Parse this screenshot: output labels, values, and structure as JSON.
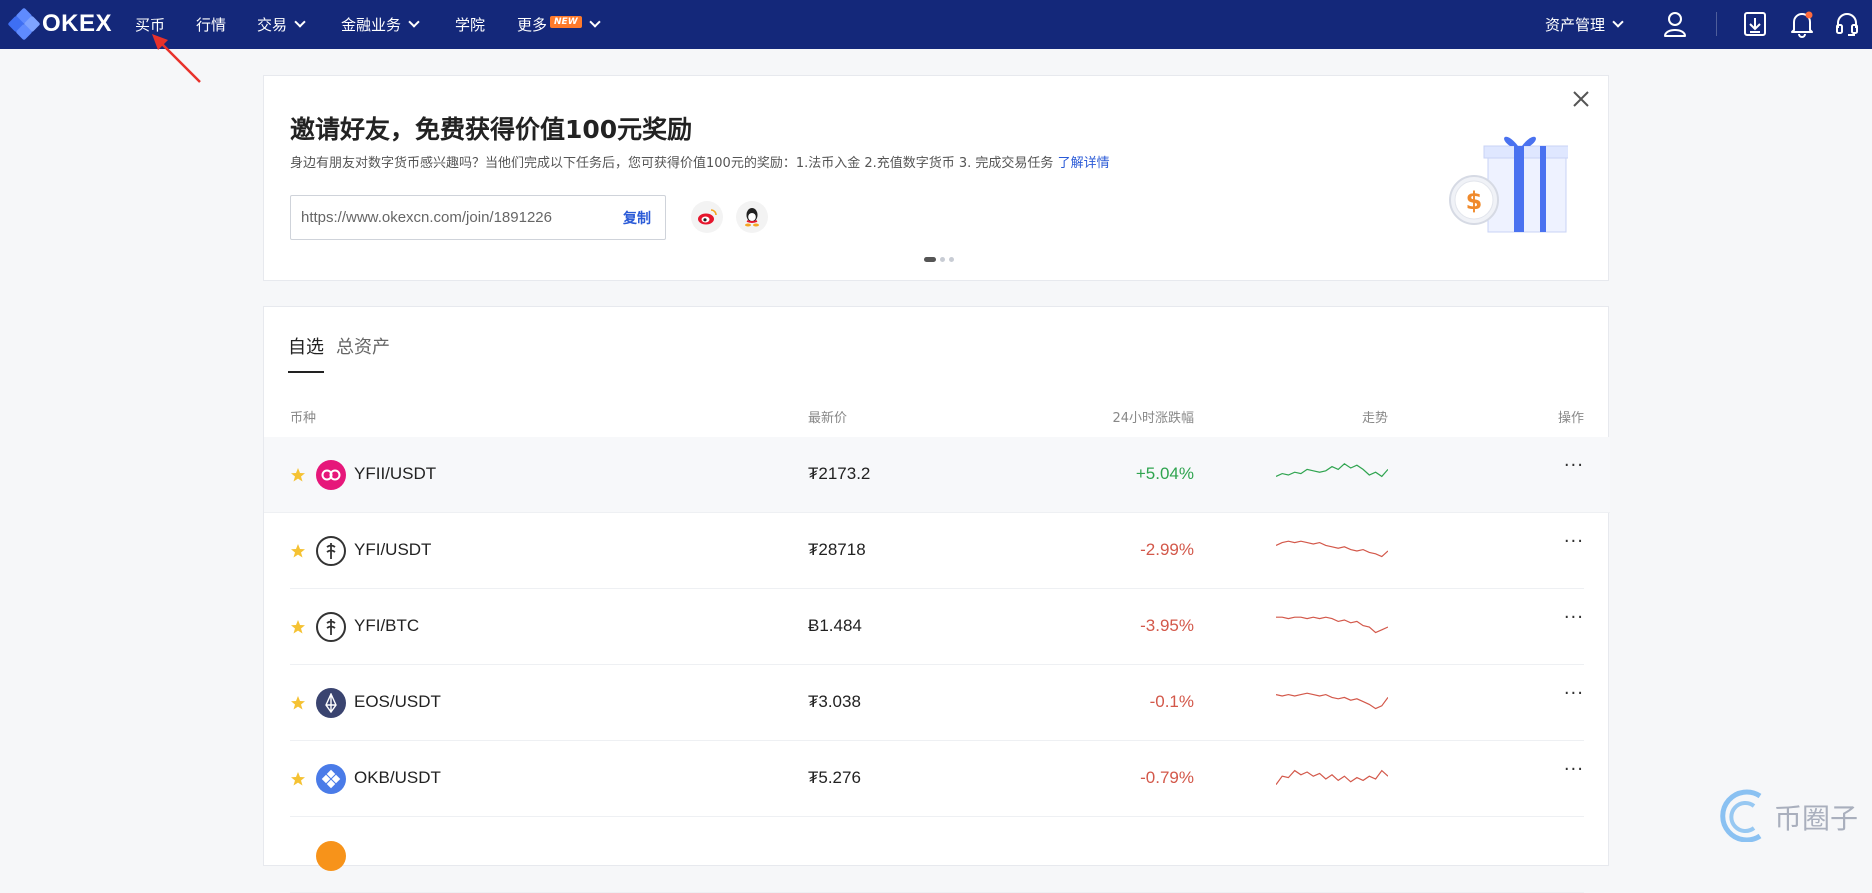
{
  "nav": {
    "logo_text": "OKEX",
    "items": [
      {
        "label": "买币",
        "has_dropdown": false
      },
      {
        "label": "行情",
        "has_dropdown": false
      },
      {
        "label": "交易",
        "has_dropdown": true
      },
      {
        "label": "金融业务",
        "has_dropdown": true
      },
      {
        "label": "学院",
        "has_dropdown": false
      },
      {
        "label": "更多",
        "has_dropdown": true,
        "badge": "NEW"
      }
    ],
    "asset_menu": "资产管理",
    "icons": [
      "user-icon",
      "download-icon",
      "bell-icon",
      "headset-icon"
    ],
    "bg_color": "#14287a"
  },
  "banner": {
    "title": "邀请好友，免费获得价值100元奖励",
    "desc": "身边有朋友对数字货币感兴趣吗？当他们完成以下任务后，您可获得价值100元的奖励：1.法币入金 2.充值数字货币 3. 完成交易任务",
    "desc_link": "了解详情",
    "invite_url": "https://www.okexcn.com/join/1891226",
    "copy_label": "复制",
    "share_icons": [
      "weibo-icon",
      "qq-icon"
    ],
    "carousel_pages": 3,
    "carousel_active": 1
  },
  "watchlist": {
    "tabs": [
      {
        "label": "自选",
        "active": true
      },
      {
        "label": "总资产",
        "active": false
      }
    ],
    "columns": {
      "coin": "币种",
      "price": "最新价",
      "change": "24小时涨跌幅",
      "trend": "走势",
      "action": "操作"
    },
    "rows": [
      {
        "pair": "YFII/USDT",
        "price": "₮2173.2",
        "change": "+5.04%",
        "direction": "up",
        "icon": "yfii-icon",
        "trend": [
          0.55,
          0.45,
          0.5,
          0.4,
          0.45,
          0.3,
          0.35,
          0.4,
          0.35,
          0.2,
          0.3,
          0.1,
          0.25,
          0.15,
          0.3,
          0.5,
          0.4,
          0.55,
          0.3
        ]
      },
      {
        "pair": "YFI/USDT",
        "price": "₮28718",
        "change": "-2.99%",
        "direction": "down",
        "icon": "yfi-icon",
        "trend": [
          0.3,
          0.2,
          0.15,
          0.2,
          0.15,
          0.2,
          0.25,
          0.2,
          0.3,
          0.35,
          0.4,
          0.35,
          0.45,
          0.5,
          0.45,
          0.55,
          0.6,
          0.7,
          0.5
        ]
      },
      {
        "pair": "YFI/BTC",
        "price": "Ƀ1.484",
        "change": "-3.95%",
        "direction": "down",
        "icon": "yfi-icon",
        "trend": [
          0.15,
          0.15,
          0.2,
          0.15,
          0.15,
          0.2,
          0.15,
          0.2,
          0.15,
          0.2,
          0.3,
          0.25,
          0.35,
          0.3,
          0.45,
          0.5,
          0.7,
          0.6,
          0.5
        ]
      },
      {
        "pair": "EOS/USDT",
        "price": "₮3.038",
        "change": "-0.1%",
        "direction": "down",
        "icon": "eos-icon",
        "trend": [
          0.2,
          0.25,
          0.2,
          0.25,
          0.2,
          0.15,
          0.2,
          0.25,
          0.2,
          0.3,
          0.35,
          0.3,
          0.4,
          0.35,
          0.45,
          0.55,
          0.7,
          0.6,
          0.3
        ]
      },
      {
        "pair": "OKB/USDT",
        "price": "₮5.276",
        "change": "-0.79%",
        "direction": "down",
        "icon": "okb-icon",
        "trend": [
          0.7,
          0.4,
          0.45,
          0.2,
          0.35,
          0.25,
          0.4,
          0.3,
          0.5,
          0.35,
          0.55,
          0.4,
          0.6,
          0.45,
          0.55,
          0.4,
          0.5,
          0.2,
          0.4
        ]
      }
    ],
    "up_color": "#2fa44f",
    "down_color": "#d3584a",
    "star_color": "#f5c233"
  },
  "watermark": {
    "text": "币圈子"
  }
}
